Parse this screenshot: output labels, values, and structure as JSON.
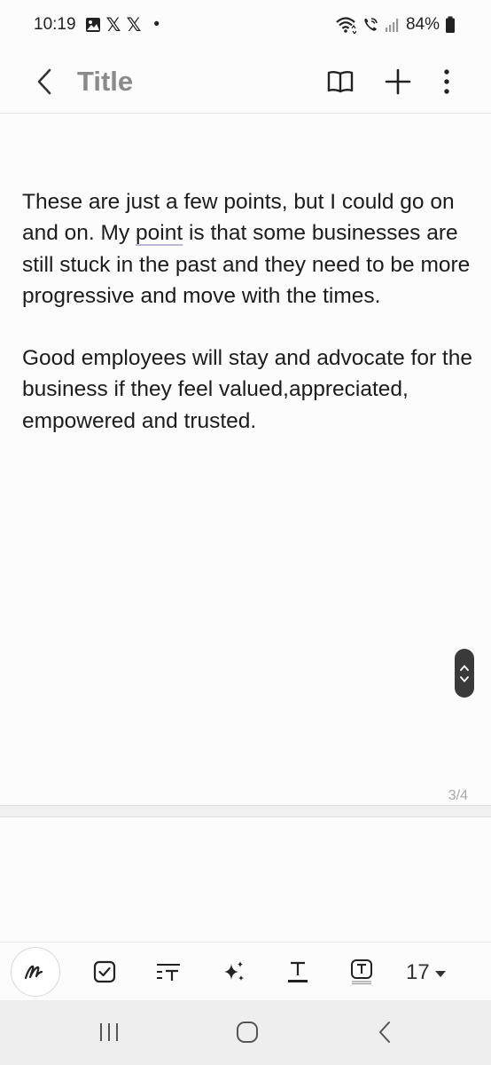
{
  "status_bar": {
    "time": "10:19",
    "notification_icons": [
      "gallery-icon",
      "x-icon",
      "x-icon",
      "dot-icon"
    ],
    "x_glyph": "𝕏",
    "dot": "•",
    "battery_percent": "84%"
  },
  "app_bar": {
    "title": "Title"
  },
  "note": {
    "paragraphs": [
      {
        "before": "These are just a few points, but I could go on and on. My ",
        "underlined": "point",
        "after": " is that some businesses are still stuck in the past and they need to be more progressive and move with the times."
      },
      {
        "text": "Good employees will stay and advocate for the business if they feel valued,appreciated, empowered and trusted."
      }
    ]
  },
  "page_indicator": "3/4",
  "toolbar": {
    "font_size": "17"
  },
  "colors": {
    "background": "#fcfcfc",
    "title_gray": "#8a8a8a",
    "scroll_handle": "#3a3a3a"
  }
}
